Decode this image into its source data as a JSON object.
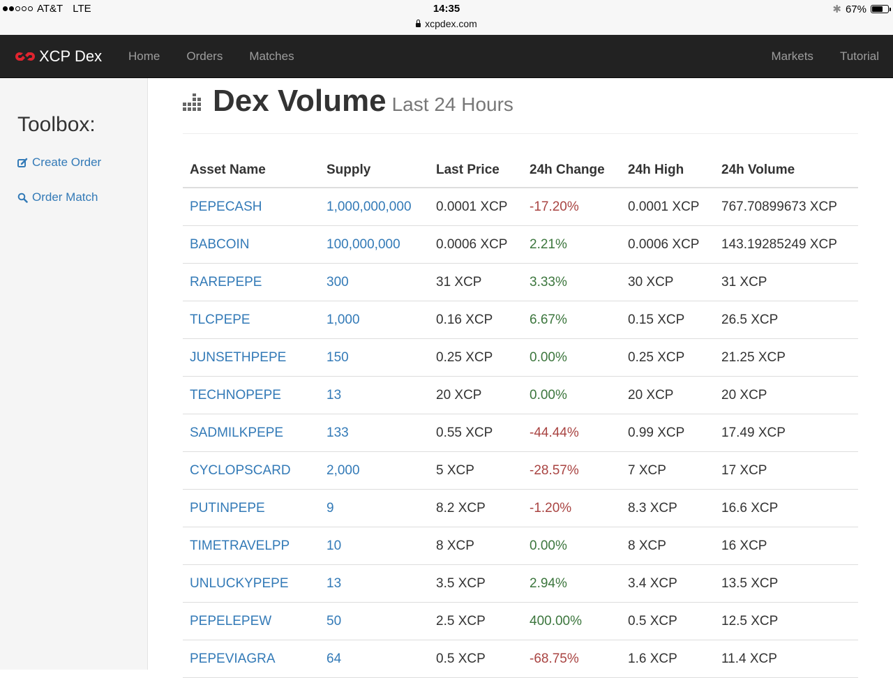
{
  "status_bar": {
    "carrier": "AT&T",
    "network": "LTE",
    "time": "14:35",
    "url": "xcpdex.com",
    "battery": "67%",
    "battery_level": 0.67
  },
  "navbar": {
    "brand": "XCP Dex",
    "links": [
      "Home",
      "Orders",
      "Matches"
    ],
    "right_links": [
      "Markets",
      "Tutorial"
    ]
  },
  "sidebar": {
    "title": "Toolbox:",
    "items": [
      {
        "label": "Create Order",
        "icon": "edit-icon"
      },
      {
        "label": "Order Match",
        "icon": "search-icon"
      }
    ]
  },
  "page": {
    "title": "Dex Volume",
    "subtitle": "Last 24 Hours"
  },
  "table": {
    "headers": [
      "Asset Name",
      "Supply",
      "Last Price",
      "24h Change",
      "24h High",
      "24h Volume"
    ],
    "rows": [
      {
        "asset": "PEPECASH",
        "supply": "1,000,000,000",
        "last": "0.0001 XCP",
        "change": "-17.20%",
        "trend": "neg",
        "high": "0.0001 XCP",
        "volume": "767.70899673 XCP"
      },
      {
        "asset": "BABCOIN",
        "supply": "100,000,000",
        "last": "0.0006 XCP",
        "change": "2.21%",
        "trend": "pos",
        "high": "0.0006 XCP",
        "volume": "143.19285249 XCP"
      },
      {
        "asset": "RAREPEPE",
        "supply": "300",
        "last": "31 XCP",
        "change": "3.33%",
        "trend": "pos",
        "high": "30 XCP",
        "volume": "31 XCP"
      },
      {
        "asset": "TLCPEPE",
        "supply": "1,000",
        "last": "0.16 XCP",
        "change": "6.67%",
        "trend": "pos",
        "high": "0.15 XCP",
        "volume": "26.5 XCP"
      },
      {
        "asset": "JUNSETHPEPE",
        "supply": "150",
        "last": "0.25 XCP",
        "change": "0.00%",
        "trend": "pos",
        "high": "0.25 XCP",
        "volume": "21.25 XCP"
      },
      {
        "asset": "TECHNOPEPE",
        "supply": "13",
        "last": "20 XCP",
        "change": "0.00%",
        "trend": "pos",
        "high": "20 XCP",
        "volume": "20 XCP"
      },
      {
        "asset": "SADMILKPEPE",
        "supply": "133",
        "last": "0.55 XCP",
        "change": "-44.44%",
        "trend": "neg",
        "high": "0.99 XCP",
        "volume": "17.49 XCP"
      },
      {
        "asset": "CYCLOPSCARD",
        "supply": "2,000",
        "last": "5 XCP",
        "change": "-28.57%",
        "trend": "neg",
        "high": "7 XCP",
        "volume": "17 XCP"
      },
      {
        "asset": "PUTINPEPE",
        "supply": "9",
        "last": "8.2 XCP",
        "change": "-1.20%",
        "trend": "neg",
        "high": "8.3 XCP",
        "volume": "16.6 XCP"
      },
      {
        "asset": "TIMETRAVELPP",
        "supply": "10",
        "last": "8 XCP",
        "change": "0.00%",
        "trend": "pos",
        "high": "8 XCP",
        "volume": "16 XCP"
      },
      {
        "asset": "UNLUCKYPEPE",
        "supply": "13",
        "last": "3.5 XCP",
        "change": "2.94%",
        "trend": "pos",
        "high": "3.4 XCP",
        "volume": "13.5 XCP"
      },
      {
        "asset": "PEPELEPEW",
        "supply": "50",
        "last": "2.5 XCP",
        "change": "400.00%",
        "trend": "pos",
        "high": "0.5 XCP",
        "volume": "12.5 XCP"
      },
      {
        "asset": "PEPEVIAGRA",
        "supply": "64",
        "last": "0.5 XCP",
        "change": "-68.75%",
        "trend": "neg",
        "high": "1.6 XCP",
        "volume": "11.4 XCP"
      }
    ]
  },
  "colors": {
    "link": "#337ab7",
    "negative": "#a94442",
    "positive": "#3c763d",
    "navbar": "#222222",
    "brand_logo": "#e0242f"
  }
}
